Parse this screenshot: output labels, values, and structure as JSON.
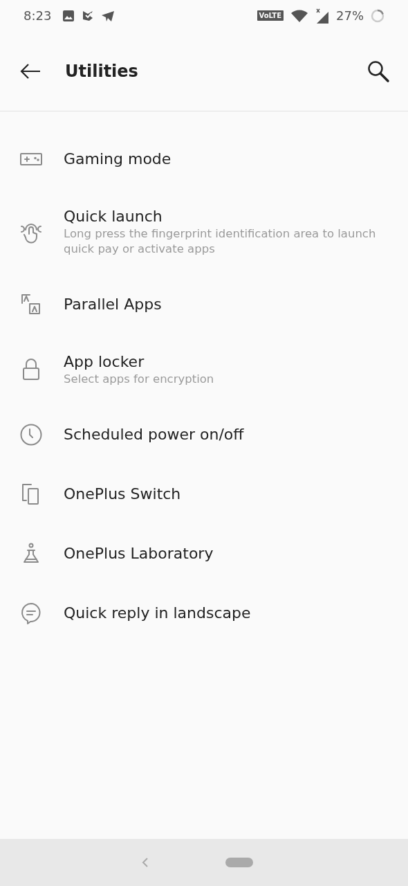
{
  "status_bar": {
    "time": "8:23",
    "network_badge": "VoLTE",
    "battery": "27%"
  },
  "header": {
    "title": "Utilities"
  },
  "items": [
    {
      "kind": "gamepad",
      "title": "Gaming mode"
    },
    {
      "kind": "fingerprint",
      "title": "Quick launch",
      "subtitle": "Long press the fingerprint identification area to launch quick pay or activate apps"
    },
    {
      "kind": "parallel",
      "title": "Parallel Apps"
    },
    {
      "kind": "lock",
      "title": "App locker",
      "subtitle": "Select apps for encryption"
    },
    {
      "kind": "clock",
      "title": "Scheduled power on/off"
    },
    {
      "kind": "devices",
      "title": "OnePlus Switch"
    },
    {
      "kind": "flask",
      "title": "OnePlus Laboratory"
    },
    {
      "kind": "chat",
      "title": "Quick reply in landscape"
    }
  ]
}
